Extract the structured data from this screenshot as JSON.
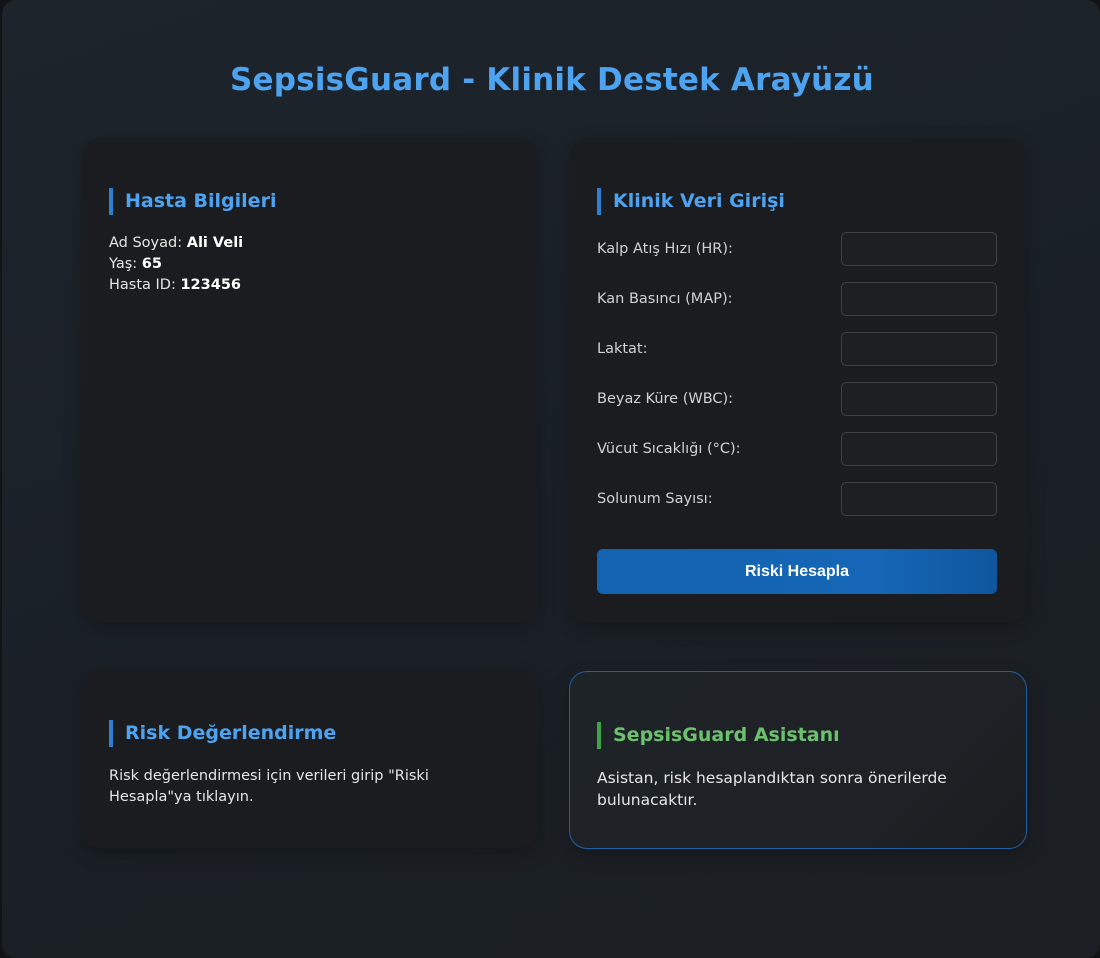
{
  "header": {
    "title": "SepsisGuard - Klinik Destek Arayüzü"
  },
  "patient": {
    "title": "Hasta Bilgileri",
    "fields": [
      {
        "label": "Ad Soyad:",
        "value": "Ali Veli"
      },
      {
        "label": "Yaş:",
        "value": "65"
      },
      {
        "label": "Hasta ID:",
        "value": "123456"
      }
    ]
  },
  "clinical": {
    "title": "Klinik Veri Girişi",
    "fields": [
      {
        "label": "Kalp Atış Hızı (HR):",
        "value": ""
      },
      {
        "label": "Kan Basıncı (MAP):",
        "value": ""
      },
      {
        "label": "Laktat:",
        "value": ""
      },
      {
        "label": "Beyaz Küre (WBC):",
        "value": ""
      },
      {
        "label": "Vücut Sıcaklığı (°C):",
        "value": ""
      },
      {
        "label": "Solunum Sayısı:",
        "value": ""
      }
    ],
    "button_label": "Riski Hesapla"
  },
  "risk": {
    "title": "Risk Değerlendirme",
    "text": "Risk değerlendirmesi için verileri girip \"Riski Hesapla\"ya tıklayın."
  },
  "assistant": {
    "title": "SepsisGuard Asistanı",
    "text": "Asistan, risk hesaplandıktan sonra önerilerde bulunacaktır."
  },
  "colors": {
    "accent": "#4da3f0",
    "assistant_accent": "#6cc06e",
    "button": "#1566b6",
    "card": "#1b1c1f",
    "background": "#1d242b"
  }
}
